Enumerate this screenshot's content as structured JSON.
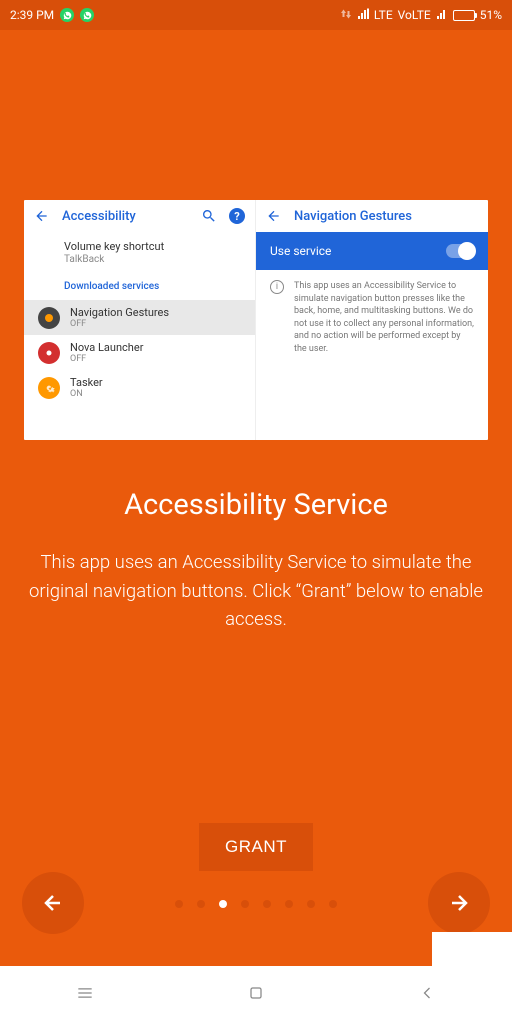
{
  "status": {
    "time": "2:39 PM",
    "network1": "LTE",
    "network2": "VoLTE",
    "battery": "51%"
  },
  "card": {
    "left": {
      "title": "Accessibility",
      "volume": {
        "title": "Volume key shortcut",
        "sub": "TalkBack"
      },
      "section": "Downloaded services",
      "apps": [
        {
          "title": "Navigation Gestures",
          "sub": "OFF"
        },
        {
          "title": "Nova Launcher",
          "sub": "OFF"
        },
        {
          "title": "Tasker",
          "sub": "ON"
        }
      ]
    },
    "right": {
      "title": "Navigation Gestures",
      "use": "Use service",
      "desc": "This app uses an Accessibility Service to simulate navigation button presses like the back, home, and multitasking buttons. We do not use it to collect any personal information, and no action will be performed except by the user."
    }
  },
  "main": {
    "title": "Accessibility Service",
    "desc": "This app uses an Accessibility Service to simulate the original navigation buttons. Click “Grant” below to enable access.",
    "grant": "GRANT"
  }
}
